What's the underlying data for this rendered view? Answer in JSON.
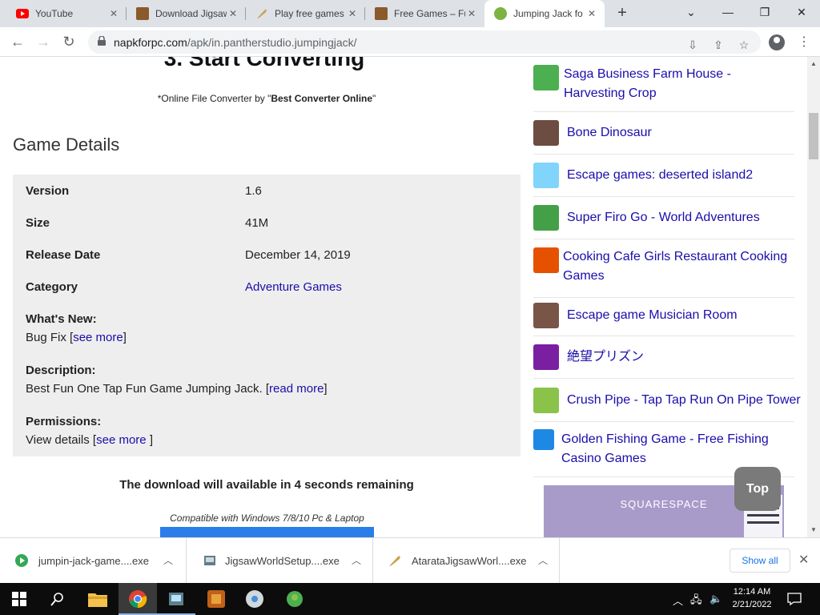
{
  "browser": {
    "tabs": [
      {
        "label": "YouTube",
        "icon": "youtube-icon"
      },
      {
        "label": "Download Jigsaw",
        "icon": "jigsaw-game-icon"
      },
      {
        "label": "Play free games",
        "icon": "feather-quill-icon"
      },
      {
        "label": "Free Games – Fu",
        "icon": "jigsaw-game-icon"
      },
      {
        "label": "Jumping Jack fo",
        "icon": "jumping-jack-icon"
      }
    ],
    "url_domain": "napkforpc.com",
    "url_path": "/apk/in.pantherstudio.jumpingjack/"
  },
  "article": {
    "step_title": "3. Start Converting",
    "converter_prefix": "*Online File Converter by \"",
    "converter_name": "Best Converter Online",
    "converter_suffix": "\"",
    "details_heading": "Game Details",
    "version_label": "Version",
    "version_value": "1.6",
    "size_label": "Size",
    "size_value": "41M",
    "release_label": "Release Date",
    "release_value": "December 14, 2019",
    "category_label": "Category",
    "category_value": "Adventure Games",
    "whatsnew_label": "What's New:",
    "whatsnew_text": "Bug Fix [",
    "whatsnew_link": "see more",
    "whatsnew_close": "]",
    "description_label": "Description:",
    "description_text": "Best Fun One Tap Fun Game Jumping Jack. [",
    "description_link": "read more",
    "description_close": "]",
    "permissions_label": "Permissions:",
    "permissions_text": "View details [",
    "permissions_link": "see more ",
    "permissions_close": "]",
    "download_message": "The download will available in 4 seconds remaining",
    "compatible": "Compatible with Windows 7/8/10 Pc & Laptop"
  },
  "sidebar": {
    "items": [
      {
        "title": "Saga Business Farm House - Harvesting Crop"
      },
      {
        "title": "Bone Dinosaur"
      },
      {
        "title": "Escape games: deserted island2"
      },
      {
        "title": "Super Firo Go - World Adventures"
      },
      {
        "title": "Cooking Cafe Girls Restaurant Cooking Games"
      },
      {
        "title": "Escape game Musician Room"
      },
      {
        "title": "絶望プリズン"
      },
      {
        "title": "Crush Pipe - Tap Tap Run On Pipe Tower"
      },
      {
        "title": "Golden Fishing Game - Free Fishing Casino Games"
      }
    ],
    "ad_brand": "SQUARESPACE",
    "top_button": "Top"
  },
  "downloads": {
    "items": [
      {
        "name": "jumpin-jack-game....exe"
      },
      {
        "name": "JigsawWorldSetup....exe"
      },
      {
        "name": "AtarataJigsawWorl....exe"
      }
    ],
    "show_all": "Show all"
  },
  "taskbar": {
    "time": "12:14 AM",
    "date": "2/21/2022"
  }
}
